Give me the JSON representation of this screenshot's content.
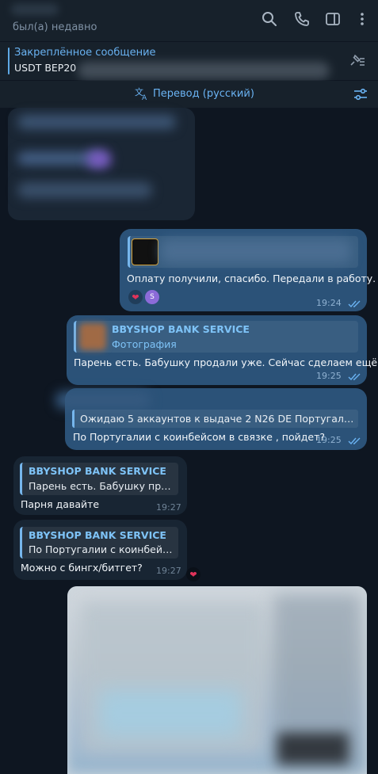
{
  "header": {
    "status": "был(а) недавно",
    "icons": [
      "search-icon",
      "phone-icon",
      "sidebar-toggle-icon",
      "more-icon"
    ]
  },
  "pinned": {
    "title": "Закреплённое сообщение",
    "text": "USDT BEP20",
    "icon": "unpin-list-icon"
  },
  "translate": {
    "label": "Перевод (русский)",
    "icon": "translate-icon",
    "settings_icon": "settings-sliders-icon"
  },
  "messages": [
    {
      "id": "m1",
      "direction": "out",
      "text": "Оплату получили, спасибо. Передали в работу.",
      "time": "19:24",
      "read": true,
      "reaction": "❤",
      "reaction_user": "S"
    },
    {
      "id": "m2",
      "direction": "out",
      "quote_title": "BBYSHOP BANK SERVICE",
      "quote_sub": "Фотография",
      "text": "Парень есть. Бабушку продали уже. Сейчас сделаем ещё.",
      "time": "19:25",
      "read": true
    },
    {
      "id": "m3",
      "direction": "out",
      "quote_text": "Ожидаю 5 аккаунтов к выдаче  2 N26 DE Португалия с...",
      "text": "По Португалии с коинбейсом в связке , пойдет?",
      "time": "19:25",
      "read": true
    },
    {
      "id": "m4",
      "direction": "in",
      "quote_title": "BBYSHOP BANK SERVICE",
      "quote_text": "Парень есть. Бабушку прод...",
      "text": "Парня давайте",
      "time": "19:27"
    },
    {
      "id": "m5",
      "direction": "in",
      "quote_title": "BBYSHOP BANK SERVICE",
      "quote_text": "По Португалии с коинбейсо...",
      "text": "Можно с бингх/битгет?",
      "time": "19:27",
      "reaction": "❤"
    }
  ],
  "colors": {
    "background": "#0e1621",
    "header": "#17212b",
    "outgoing": "#2b5278",
    "incoming": "#182533",
    "accent": "#6ab3f3"
  }
}
